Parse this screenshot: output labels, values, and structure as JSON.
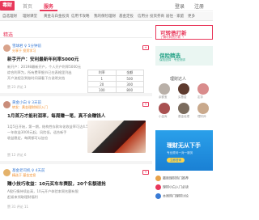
{
  "header": {
    "logo": "毒财",
    "nav_home": "首页",
    "nav_service": "服务",
    "login": "登录",
    "register": "注册"
  },
  "categories": [
    {
      "label": "自选理财"
    },
    {
      "label": "理财课堂"
    },
    {
      "label": "黄金与白金投资"
    },
    {
      "label": "信用卡攻略"
    },
    {
      "label": "我的保险理财"
    },
    {
      "label": "基金定投"
    },
    {
      "label": "信用分"
    },
    {
      "label": "投资券商"
    },
    {
      "label": "居住 · 家庭"
    },
    {
      "label": "更多"
    }
  ],
  "feed": {
    "tab_label": "精选",
    "posts": [
      {
        "author": "雪球君 ♀ 5分钟前",
        "meta": "分享于 投资学习",
        "title": "新手开户：安利最新年利率5000元",
        "lines": [
          "新开户：20198最新开户，个人开户利率5000元",
          "综合利率为，所有费率细节已在表格里列出",
          "开户流程及到账时间请看下方说明文档"
        ],
        "actions": "赞 23   评论 3",
        "follow": "+"
      },
      {
        "author": "黄金小白 ♀ 3天前",
        "meta": "转发：黄金理财知识入门",
        "title": "1月首万才能利润率，每周赚一笔，真不会赚钱人",
        "lines": [
          "1月5日开始，第一期，结构性存款年化收益率可达4.5%",
          "一年收益3000元起，风险低，适合新手",
          "收益稳定，每周都可以加仓"
        ],
        "actions": "赞 12   评论 6",
        "follow": "+"
      },
      {
        "author": "基金老司机 ♀ 4天前",
        "meta": "精选于 基金定投",
        "title": "赚小技巧收益：10元买车车赛股，20个名额速抢",
        "lines": [
          "A股行情持续走高，10元开户体验本周名额有限",
          "赶紧来领取理财福利"
        ],
        "actions": "赞 31   评论 11",
        "follow": "+"
      }
    ],
    "rate_table": [
      [
        "利率",
        "金额"
      ],
      [
        "1",
        "500"
      ],
      [
        "20",
        "300"
      ],
      [
        "100",
        "800"
      ]
    ]
  },
  "sidebar": {
    "ad1_title": "可转债打新",
    "ad1_sub": "了解可转债打新 →",
    "ad2_title": "保险精选",
    "ad2_sub": "保险选择 · 专业测评",
    "pick_title": "理财达人",
    "picks": [
      {
        "label": "余额宝"
      },
      {
        "label": "买基金"
      },
      {
        "label": "定存"
      },
      {
        "label": "小金库"
      },
      {
        "label": "基金经理"
      },
      {
        "label": "理财师"
      }
    ],
    "ad3_title": "理财无从下手",
    "ad3_sub": "专业顾问一对一服务",
    "ad3_btn": "立即咨询",
    "list": [
      {
        "label": "最新理财热门推荐"
      },
      {
        "label": "理财小白入门必读"
      },
      {
        "label": "本周热门理财讨论"
      }
    ]
  }
}
